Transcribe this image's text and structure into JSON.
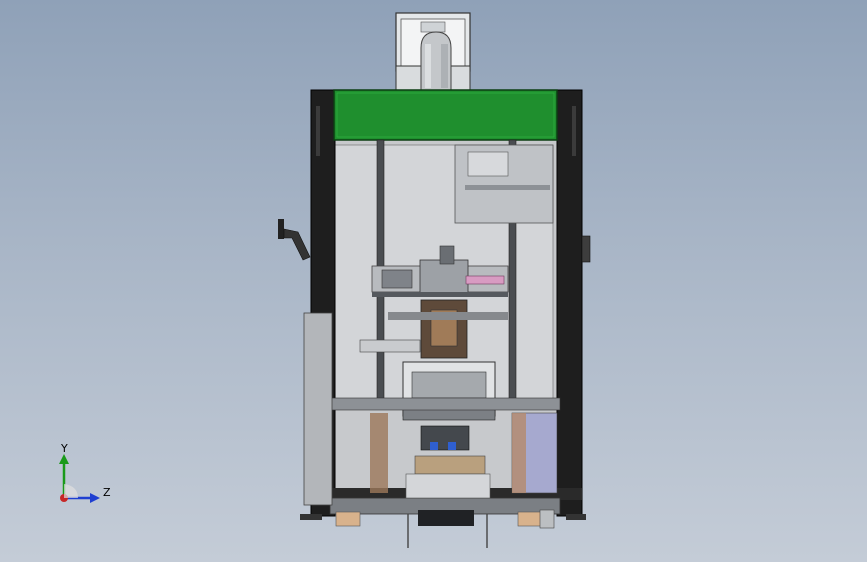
{
  "viewport": {
    "background_top": "#8fa1b8",
    "background_bottom": "#c4ccd7"
  },
  "model": {
    "description_icon": "machine-cabinet-icon",
    "top_panel_color": "#1f8f2e",
    "frame_color": "#1c1c1c",
    "pipe_color": "#c9c9c9"
  },
  "triad": {
    "y_label": "Y",
    "z_label": "Z",
    "y_color": "#1a9a1a",
    "z_color": "#1f3fd1",
    "x_color": "#c62828"
  }
}
